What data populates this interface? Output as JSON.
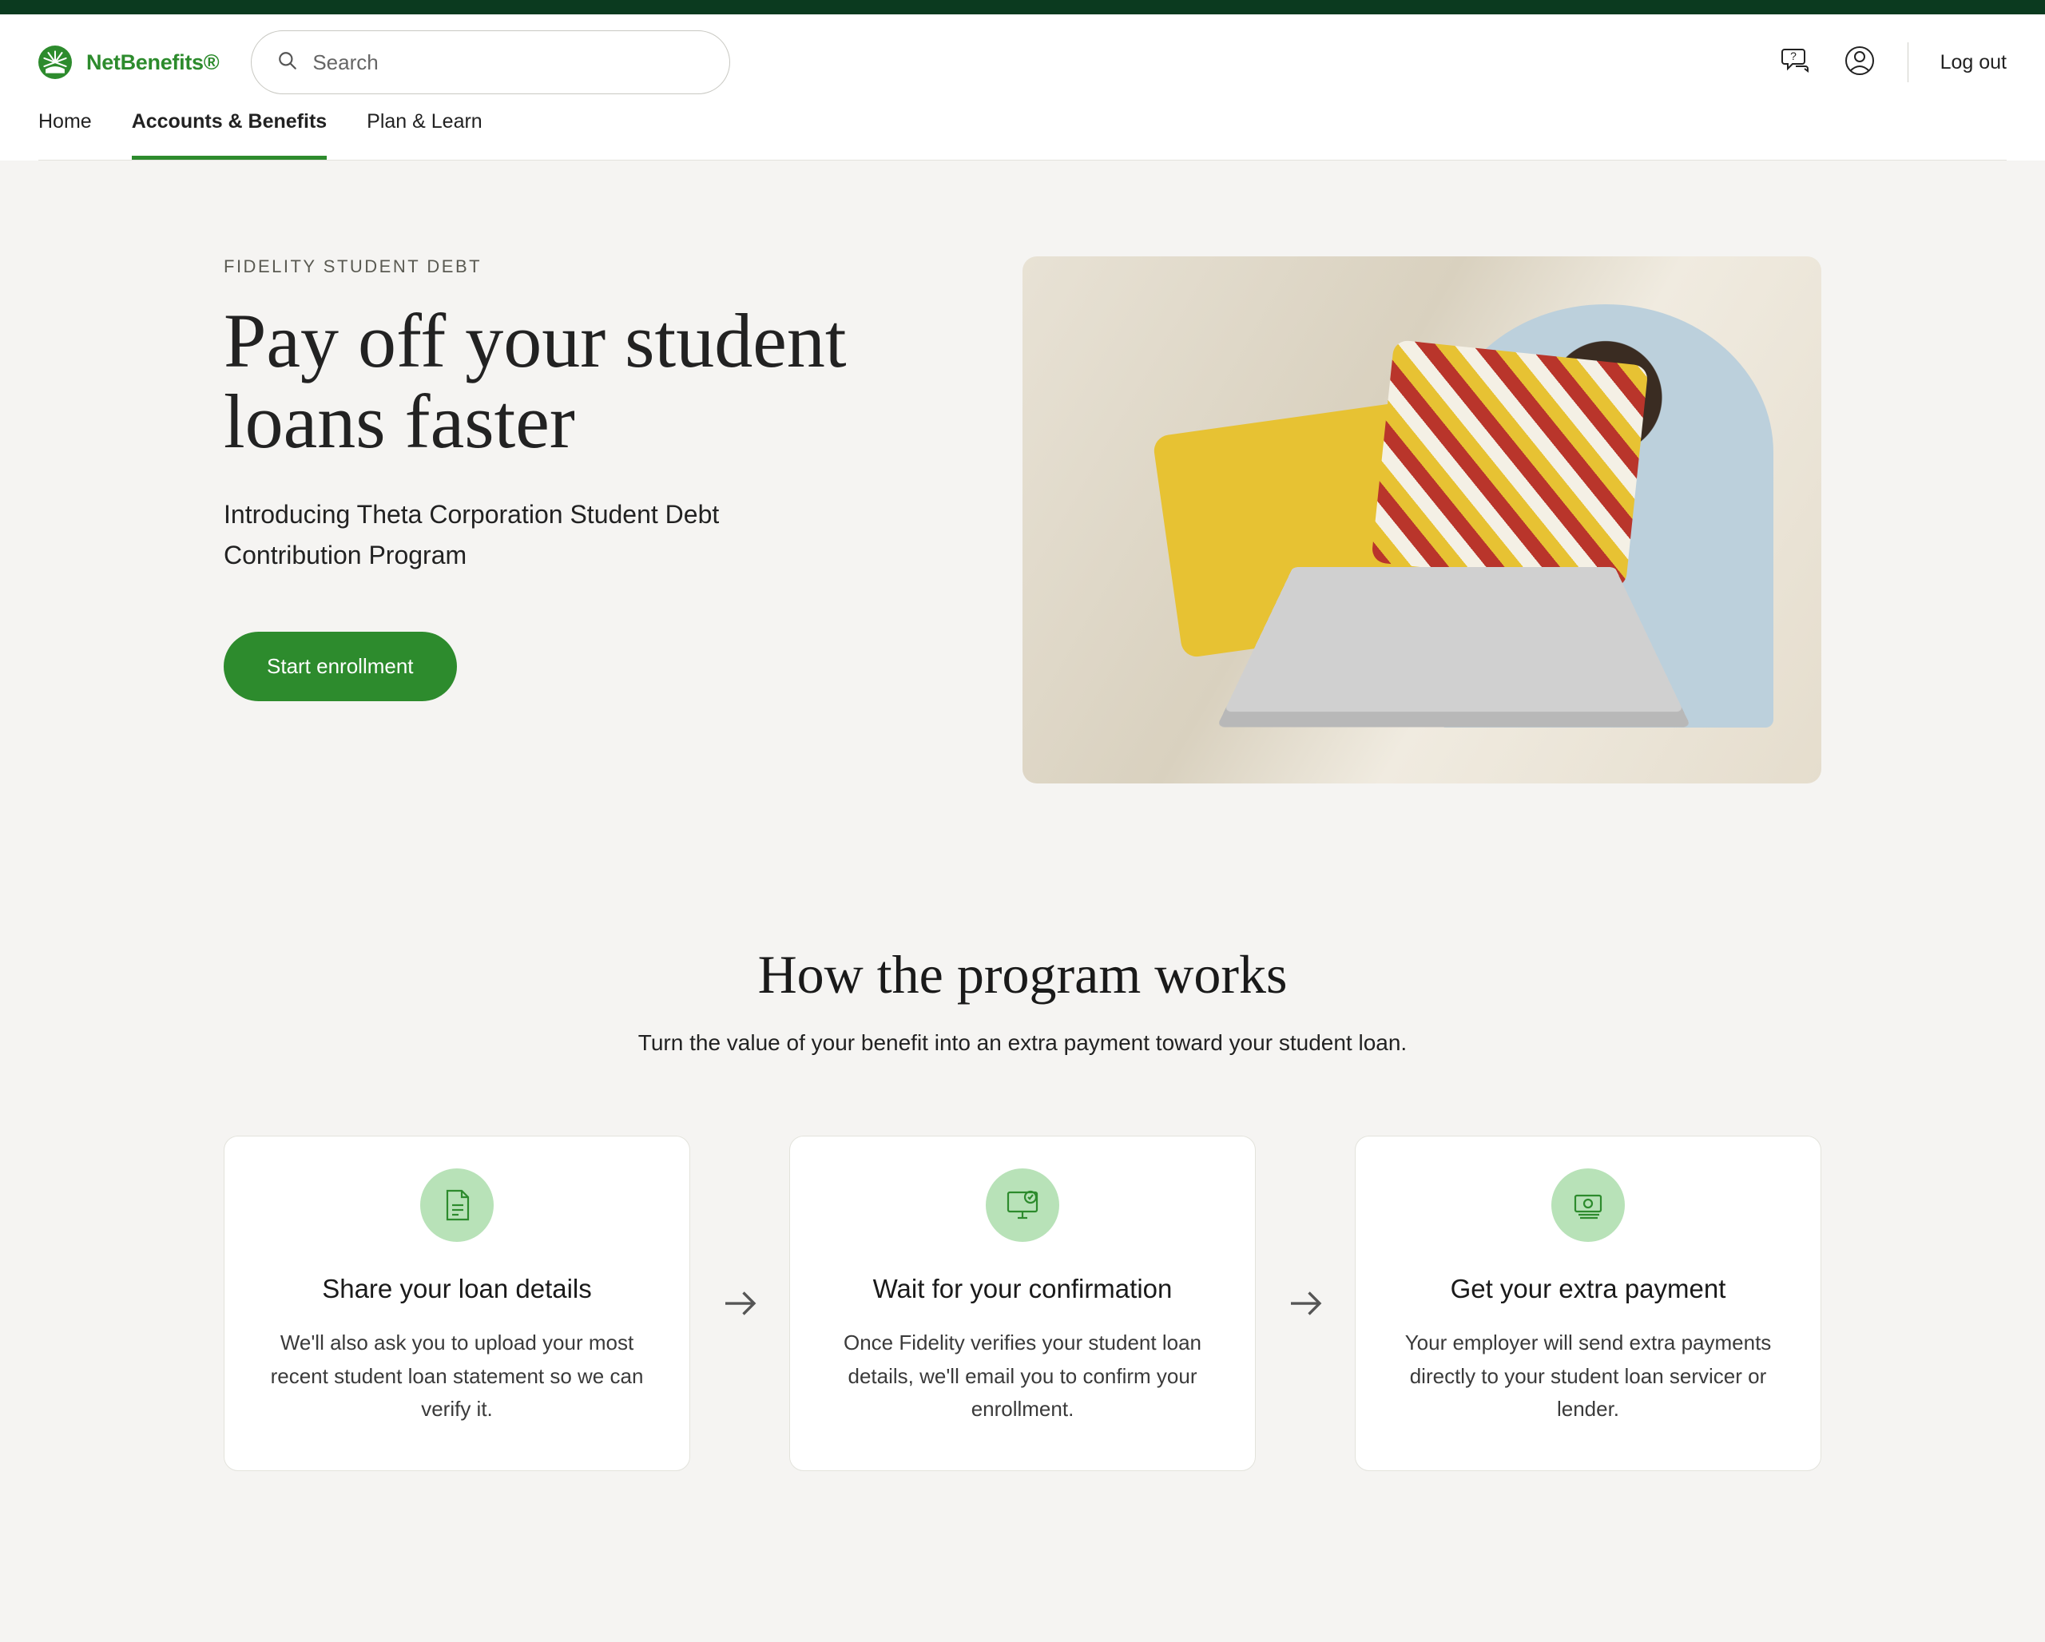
{
  "brand": {
    "name": "NetBenefits®"
  },
  "search": {
    "placeholder": "Search"
  },
  "header": {
    "logout": "Log out"
  },
  "nav": {
    "items": [
      {
        "label": "Home",
        "active": false
      },
      {
        "label": "Accounts & Benefits",
        "active": true
      },
      {
        "label": "Plan & Learn",
        "active": false
      }
    ]
  },
  "hero": {
    "eyebrow": "FIDELITY STUDENT DEBT",
    "title": "Pay off your student loans faster",
    "subtitle": "Introducing Theta Corporation Student Debt Contribution Program",
    "cta": "Start enrollment"
  },
  "how": {
    "title": "How the program works",
    "subtitle": "Turn the value of your benefit into an extra payment toward your student loan.",
    "steps": [
      {
        "icon": "document-icon",
        "title": "Share your loan details",
        "body": "We'll also ask you to upload your most recent student loan statement so we can verify it."
      },
      {
        "icon": "monitor-check-icon",
        "title": "Wait for your confirmation",
        "body": "Once Fidelity verifies your student loan details, we'll email you to confirm your enrollment."
      },
      {
        "icon": "money-icon",
        "title": "Get your extra payment",
        "body": "Your employer will send extra payments directly to your student loan servicer or lender."
      }
    ]
  }
}
